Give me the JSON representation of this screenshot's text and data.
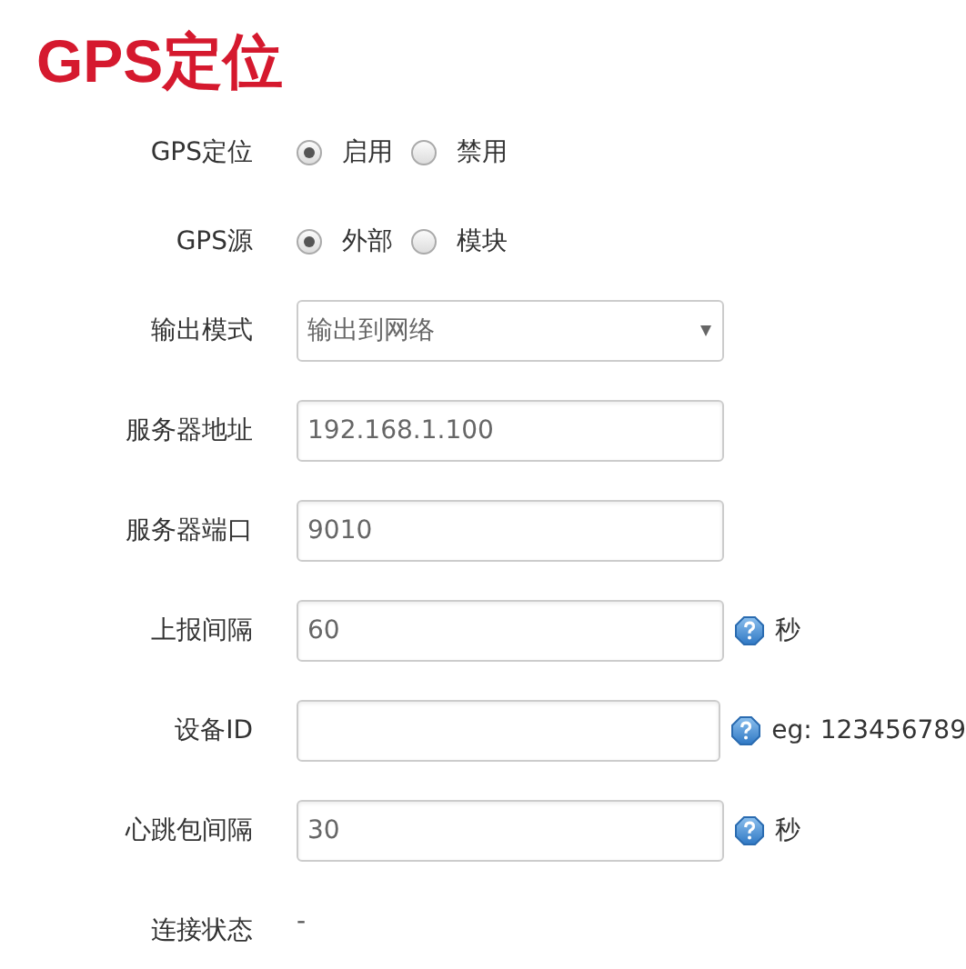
{
  "title": "GPS定位",
  "fields": [
    {
      "kind": "radio",
      "label": "GPS定位",
      "options": [
        {
          "label": "启用",
          "selected": true
        },
        {
          "label": "禁用",
          "selected": false
        }
      ]
    },
    {
      "kind": "radio",
      "label": "GPS源",
      "options": [
        {
          "label": "外部",
          "selected": true
        },
        {
          "label": "模块",
          "selected": false
        }
      ]
    },
    {
      "kind": "select",
      "label": "输出模式",
      "value": "输出到网络"
    },
    {
      "kind": "input",
      "label": "服务器地址",
      "value": "192.168.1.100"
    },
    {
      "kind": "input",
      "label": "服务器端口",
      "value": "9010"
    },
    {
      "kind": "input",
      "label": "上报间隔",
      "value": "60",
      "hint": "秒"
    },
    {
      "kind": "input",
      "label": "设备ID",
      "hint": "eg: 123456789"
    },
    {
      "kind": "input",
      "label": "心跳包间隔",
      "value": "30",
      "hint": "秒"
    },
    {
      "kind": "text",
      "label": "连接状态",
      "value": "-"
    }
  ]
}
